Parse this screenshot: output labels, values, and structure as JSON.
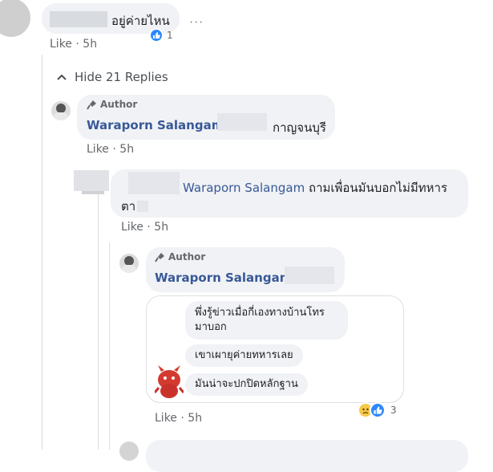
{
  "comment1": {
    "text": "อยู่ค่ายไหน",
    "like": "Like",
    "time": "5h",
    "reaction_count": "1"
  },
  "hide_replies": "Hide 21 Replies",
  "reply1": {
    "author_badge": "Author",
    "name": "Waraporn Salangam",
    "text": "กาญจนบุรี",
    "like": "Like",
    "time": "5h"
  },
  "reply2": {
    "name": "Waraporn Salangam",
    "text_line1": "ถามเพื่อนมันบอกไม่มีทหาร",
    "text_line2": "ตา",
    "like": "Like",
    "time": "5h"
  },
  "reply3": {
    "author_badge": "Author",
    "name": "Waraporn Salangam",
    "messages": [
      "พึ่งรู้ข่าวเมื่อกี่เองทางบ้านโทร",
      "มาบอก",
      "เขาเผายุค่ายทหารเลย",
      "มันน่าจะปกปิดหลักฐาน"
    ],
    "like": "Like",
    "time": "5h",
    "reaction_count": "3"
  },
  "colors": {
    "name_blue": "#385898",
    "bubble_gray": "#f0f2f5",
    "meta_gray": "#65676b"
  }
}
